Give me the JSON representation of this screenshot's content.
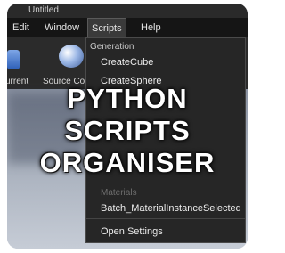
{
  "window": {
    "title": "Untitled"
  },
  "menubar": {
    "items": [
      {
        "label": "Edit"
      },
      {
        "label": "Window"
      },
      {
        "label": "Scripts"
      },
      {
        "label": "Help"
      }
    ]
  },
  "toolbar": {
    "current_label": "urrent",
    "source_control_label": "Source Co"
  },
  "scripts_menu": {
    "section_header": "Generation",
    "items": [
      {
        "label": "CreateCube"
      },
      {
        "label": "CreateSphere"
      }
    ],
    "faded_header": "Materials",
    "batch_item": "Batch_MaterialInstanceSelected",
    "settings_item": "Open Settings"
  },
  "overlay": {
    "line1": "PYTHON",
    "line2": "SCRIPTS",
    "line3": "ORGANISER"
  },
  "colors": {
    "menubar_bg": "#151515",
    "dropdown_bg": "#262626",
    "viewport_gradient_bottom": "#c6ccd6"
  }
}
